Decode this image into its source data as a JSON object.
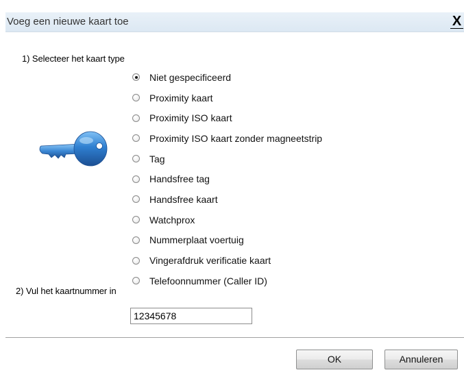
{
  "dialog": {
    "title": "Voeg een nieuwe kaart toe",
    "close_label": "X"
  },
  "section1": {
    "label": "1) Selecteer het kaart type",
    "icon": "key-icon",
    "selected_index": 0,
    "options": [
      "Niet gespecificeerd",
      "Proximity kaart",
      "Proximity ISO kaart",
      "Proximity ISO kaart zonder magneetstrip",
      "Tag",
      "Handsfree tag",
      "Handsfree kaart",
      "Watchprox",
      "Nummerplaat voertuig",
      "Vingerafdruk verificatie kaart",
      "Telefoonnummer (Caller ID)"
    ]
  },
  "section2": {
    "label": "2) Vul het kaartnummer in",
    "card_number": "12345678"
  },
  "buttons": {
    "ok_label": "OK",
    "cancel_label": "Annuleren"
  },
  "colors": {
    "titlebar": "#dce8f3",
    "key": "#2f7fd0"
  }
}
